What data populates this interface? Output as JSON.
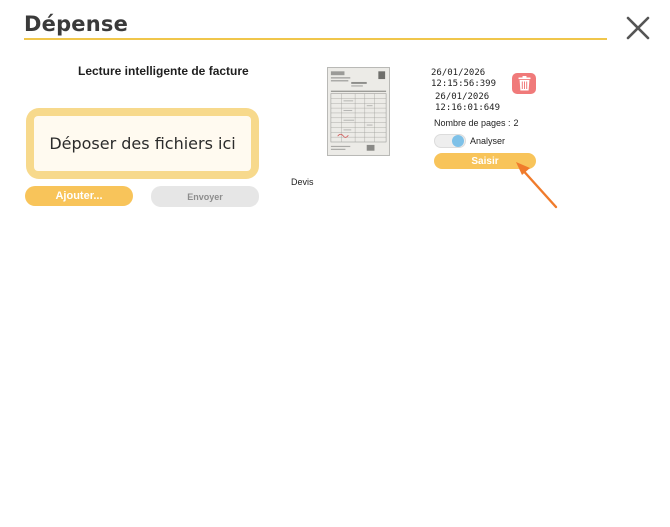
{
  "dialog": {
    "title": "Dépense",
    "close_icon": "close-icon"
  },
  "upload": {
    "section_label": "Lecture intelligente de facture",
    "dropzone_text": "Déposer des fichiers ici",
    "add_label": "Ajouter...",
    "send_label": "Envoyer"
  },
  "document": {
    "type_label": "Devis",
    "date_created": "26/01/2026 12:15:56:399",
    "date_created_day": "26/01/2026",
    "date_created_time": "12:15:56:399",
    "date_modified_day": "26/01/2026",
    "date_modified_time": "12:16:01:649",
    "pages_label": "Nombre de pages :",
    "pages_value": "2",
    "analyze_label": "Analyser",
    "analyze_enabled": true,
    "enter_label": "Saisir",
    "delete_icon": "trash-icon"
  },
  "colors": {
    "accent": "#f8c45a",
    "title_rule": "#f0c64b",
    "dropzone_border": "#f7d98c",
    "delete": "#f07a7a",
    "toggle_knob": "#7ec1e8",
    "annotation_arrow": "#f07b2b"
  }
}
